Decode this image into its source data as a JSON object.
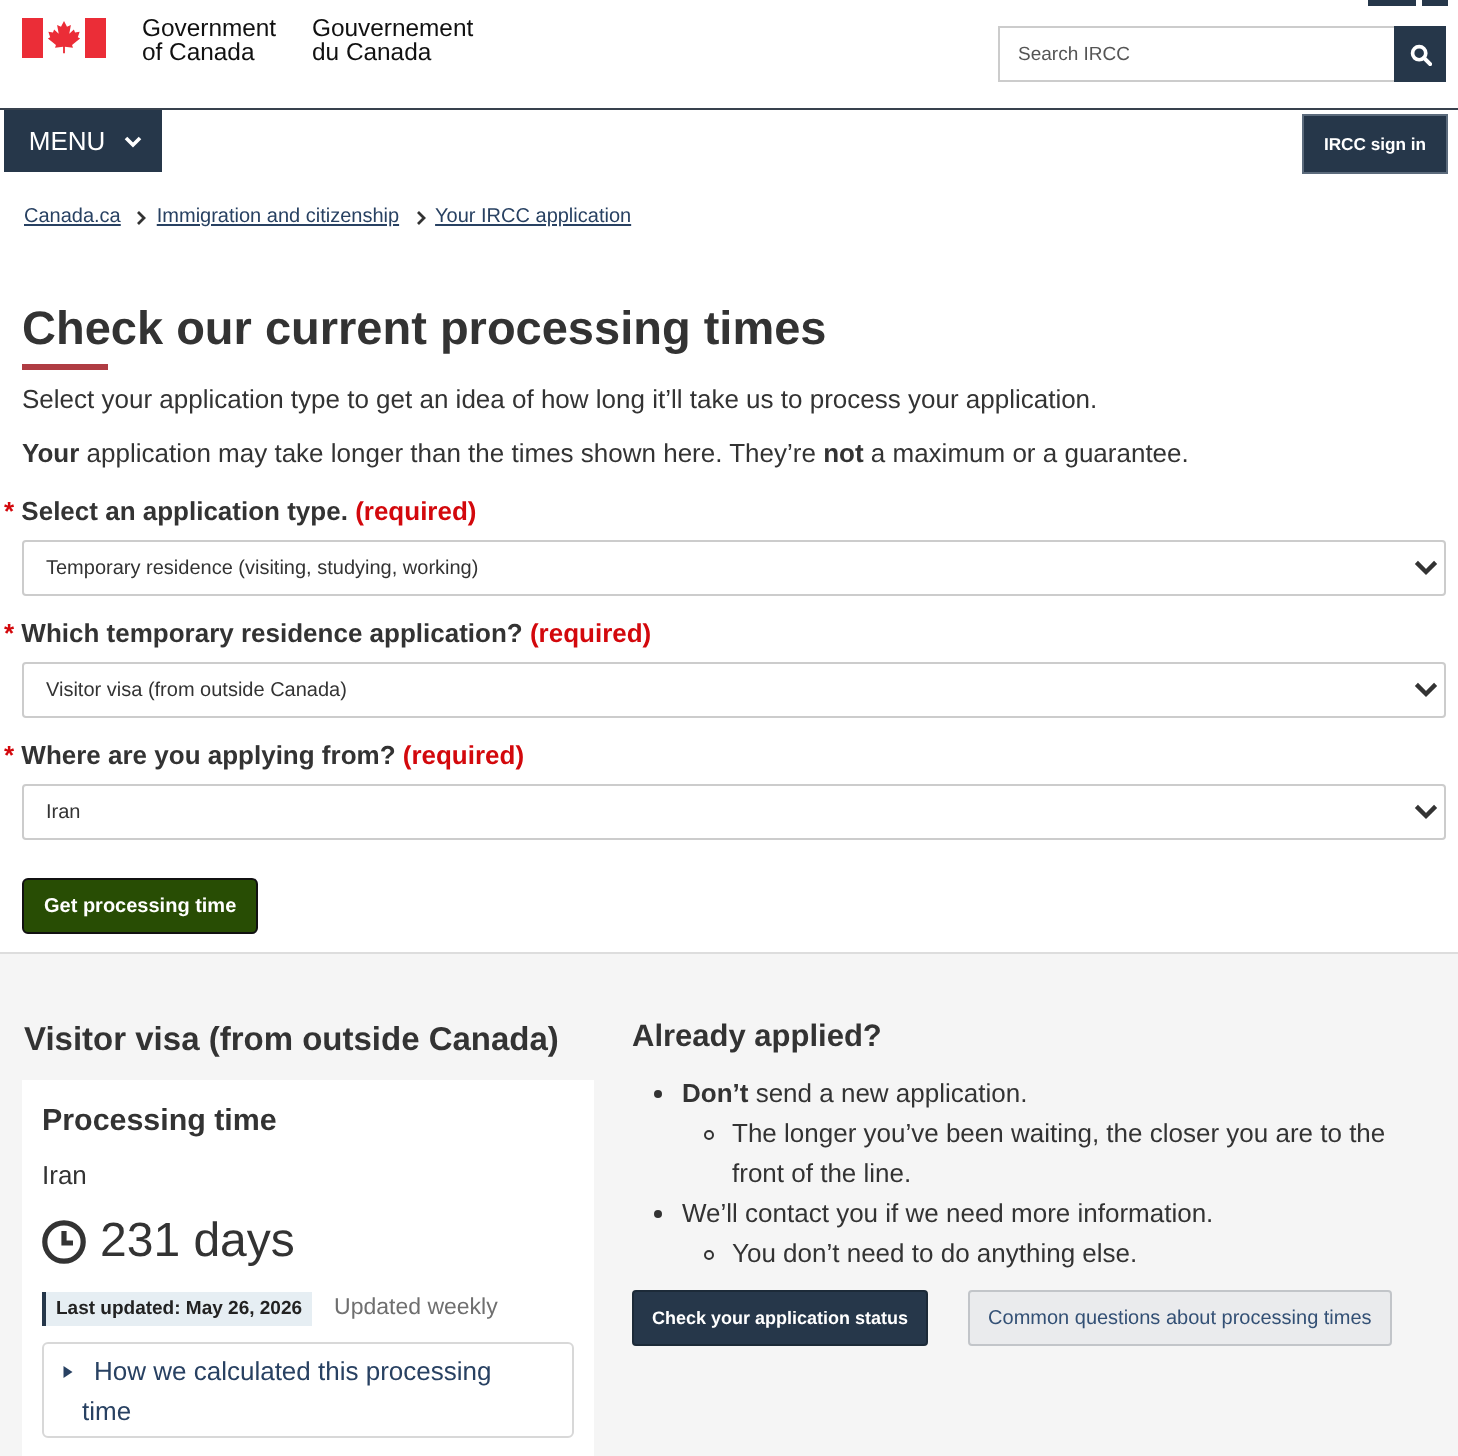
{
  "header": {
    "signature": {
      "english": [
        "Government",
        "of Canada"
      ],
      "french": [
        "Gouvernement",
        "du Canada"
      ]
    },
    "search": {
      "placeholder": "Search IRCC"
    }
  },
  "nav": {
    "menu_button": "MENU",
    "sign_in_button": "IRCC sign in"
  },
  "breadcrumbs": [
    "Canada.ca",
    "Immigration and citizenship",
    "Your IRCC application"
  ],
  "title": "Check our current processing times",
  "intro": [
    "Select your application type to get an idea of how long it’ll take us to process your application.",
    "**Your** application may take longer than the times shown here. They’re **not** a maximum or a guarantee."
  ],
  "fields": [
    {
      "marker": "*",
      "label": "Select an application type.",
      "note": "(required)",
      "value": "Temporary residence (visiting, studying, working)"
    },
    {
      "marker": "*",
      "label": "Which temporary residence application?",
      "note": "(required)",
      "value": "Visitor visa (from outside Canada)"
    },
    {
      "marker": "*",
      "label": "Where are you applying from?",
      "note": "(required)",
      "value": "Iran"
    }
  ],
  "submit_button": "Get processing time",
  "result": {
    "heading": "Visitor visa (from outside Canada)",
    "card": {
      "title": "Processing time",
      "location": "Iran",
      "duration": "231 days",
      "last_updated": "Last updated: May 26, 2026",
      "frequency": "Updated weekly",
      "details": {
        "summary": "How we calculated this processing time",
        "expanded": false
      }
    }
  },
  "already_applied": {
    "heading": "Already applied?",
    "items": [
      {
        "text": "**Don’t** send a new application.",
        "children": [
          {
            "text": "The longer you’ve been waiting, the closer you are to the front of the line."
          }
        ]
      },
      {
        "text": "We’ll contact you if we need more information.",
        "children": [
          {
            "text": "You don’t need to do anything else."
          }
        ]
      }
    ],
    "buttons": [
      {
        "label": "Check your application status",
        "kind": "primary"
      },
      {
        "label": "Common questions about processing times",
        "kind": "secondary"
      }
    ]
  }
}
